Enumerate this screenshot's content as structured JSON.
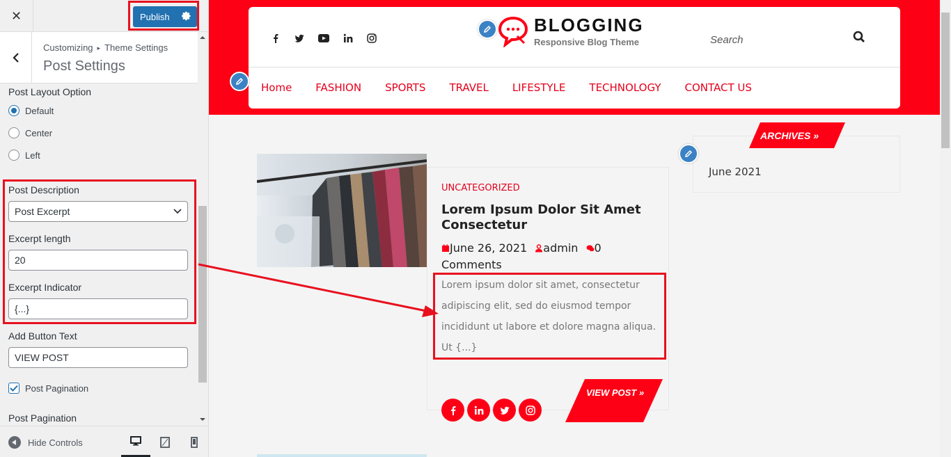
{
  "sidebar": {
    "close_glyph": "✕",
    "publish_label": "Publish",
    "breadcrumb_root": "Customizing",
    "breadcrumb_section": "Theme Settings",
    "section_title": "Post Settings",
    "layout_title": "Post Layout Option",
    "layout_options": [
      "Default",
      "Center",
      "Left"
    ],
    "layout_selected": "Default",
    "description_title": "Post Description",
    "description_value": "Post Excerpt",
    "excerpt_length_title": "Excerpt length",
    "excerpt_length_value": "20",
    "excerpt_indicator_title": "Excerpt Indicator",
    "excerpt_indicator_value": "{...}",
    "button_text_title": "Add Button Text",
    "button_text_value": "VIEW POST",
    "pagination_checkbox_label": "Post Pagination",
    "pagination_checked": true,
    "pagination_title": "Post Pagination",
    "hide_controls_label": "Hide Controls",
    "devices": [
      "desktop-icon",
      "tablet-icon",
      "mobile-icon"
    ],
    "active_device": "desktop"
  },
  "preview": {
    "social_icons": [
      "facebook-icon",
      "twitter-icon",
      "youtube-icon",
      "linkedin-icon",
      "instagram-icon"
    ],
    "logo_title": "BLOGGING",
    "logo_tagline": "Responsive Blog Theme",
    "search_placeholder": "Search",
    "nav": [
      "Home",
      "FASHION",
      "SPORTS",
      "TRAVEL",
      "LIFESTYLE",
      "TECHNOLOGY",
      "CONTACT US"
    ],
    "post": {
      "category": "UNCATEGORIZED",
      "title": "Lorem Ipsum Dolor Sit Amet Consectetur",
      "date": "June 26, 2021",
      "author": "admin",
      "comments": "0 Comments",
      "excerpt": "Lorem ipsum dolor sit amet, consectetur adipiscing elit, sed do eiusmod tempor incididunt ut labore et dolore magna aliqua. Ut {...}",
      "share_icons": [
        "facebook-icon",
        "linkedin-icon",
        "twitter-icon",
        "instagram-icon"
      ],
      "view_button": "VIEW POST »"
    },
    "archives_title": "ARCHIVES »",
    "archives": [
      "June 2021"
    ]
  },
  "colors": {
    "accent_red": "#fe0016",
    "wp_blue": "#2271b1",
    "highlight_red": "#e8101e"
  }
}
